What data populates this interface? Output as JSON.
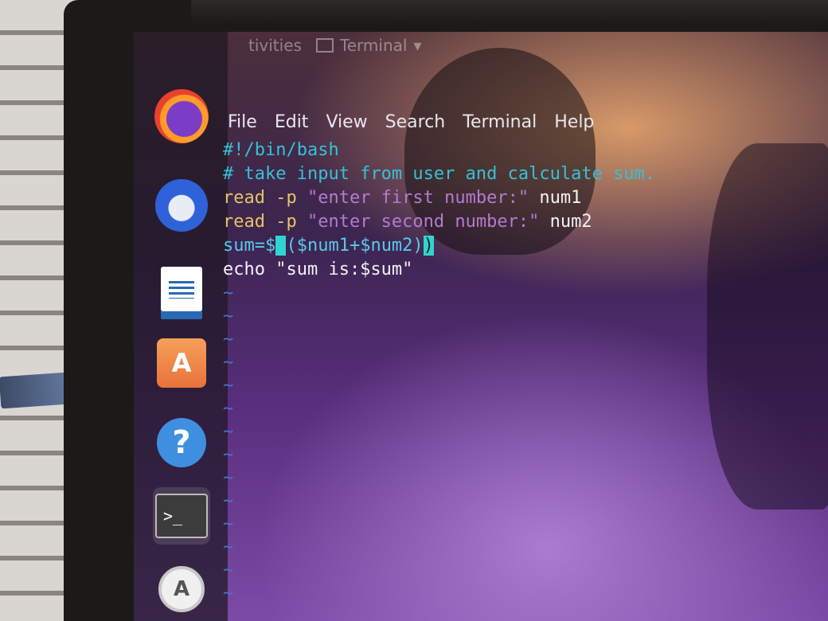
{
  "topbar": {
    "activities": "tivities",
    "app_name": "Terminal",
    "app_caret": "▾"
  },
  "dock": {
    "items": [
      {
        "name": "Firefox"
      },
      {
        "name": "Thunderbird"
      },
      {
        "name": "LibreOffice Writer"
      },
      {
        "name": "Ubuntu Software",
        "glyph": "A"
      },
      {
        "name": "Help",
        "glyph": "?"
      },
      {
        "name": "Terminal",
        "glyph": ">_"
      },
      {
        "name": "Software Updater",
        "glyph": "A"
      }
    ]
  },
  "terminal": {
    "menu": [
      "File",
      "Edit",
      "View",
      "Search",
      "Terminal",
      "Help"
    ],
    "script": {
      "line1": "#!/bin/bash",
      "line2": "# take input from user and calculate sum.",
      "line3_cmd": "read -p ",
      "line3_str": "\"enter first number:\"",
      "line3_var": " num1",
      "line4_cmd": "read -p ",
      "line4_str": "\"enter second number:\"",
      "line4_var": " num2",
      "line5_a": "sum=$",
      "line5_cursor": "(",
      "line5_b": "($num1+$num2)",
      "line5_c": ")",
      "line6": "echo \"sum is:$sum\""
    },
    "empty_line_marker": "~"
  },
  "colors": {
    "comment": "#37c0d8",
    "keyword": "#e6c36a",
    "string": "#b57ad0",
    "variable": "#5cc8e8",
    "cursor": "#2fd6d1",
    "tilde": "#4a74c9"
  }
}
